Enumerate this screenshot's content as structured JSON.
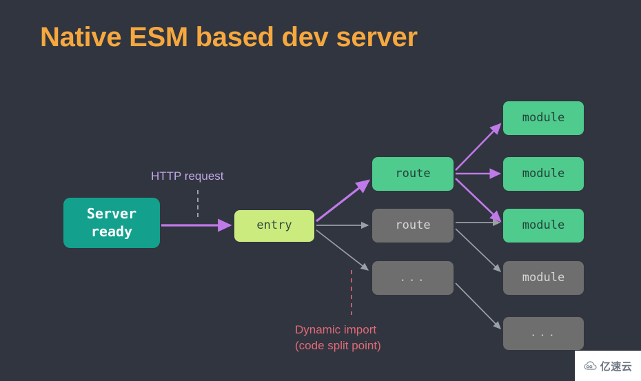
{
  "slide": {
    "title": "Native ESM based dev server",
    "background_color": "#30353f",
    "title_color": "#f6a83f"
  },
  "nodes": {
    "server": {
      "label": "Server\nready",
      "color": "#13a18d",
      "text_color": "#ffffff"
    },
    "entry": {
      "label": "entry",
      "color": "#cbeb7f",
      "text_color": "#2c4a3a"
    },
    "route_active": {
      "label": "route",
      "color": "#4ecb8d",
      "text_color": "#25413a"
    },
    "route_inactive": {
      "label": "route",
      "color": "#6e6e6e",
      "text_color": "#d7d7d7"
    },
    "route_dots": {
      "label": "...",
      "color": "#6e6e6e",
      "text_color": "#bdbdbd"
    },
    "module_1": {
      "label": "module",
      "color": "#4ecb8d",
      "text_color": "#25413a"
    },
    "module_2": {
      "label": "module",
      "color": "#4ecb8d",
      "text_color": "#25413a"
    },
    "module_3": {
      "label": "module",
      "color": "#4ecb8d",
      "text_color": "#25413a"
    },
    "module_4": {
      "label": "module",
      "color": "#6e6e6e",
      "text_color": "#d7d7d7"
    },
    "module_dots": {
      "label": "...",
      "color": "#6e6e6e",
      "text_color": "#bdbdbd"
    }
  },
  "annotations": {
    "http_request": {
      "label": "HTTP request",
      "color": "#c3a9e8"
    },
    "dynamic_import": {
      "label": "Dynamic import\n(code split point)",
      "color": "#e06a77"
    }
  },
  "edges": {
    "active_color": "#c07ae8",
    "inactive_color": "#9aa0a8"
  },
  "watermark": {
    "text": "亿速云",
    "icon": "cloud-icon"
  }
}
